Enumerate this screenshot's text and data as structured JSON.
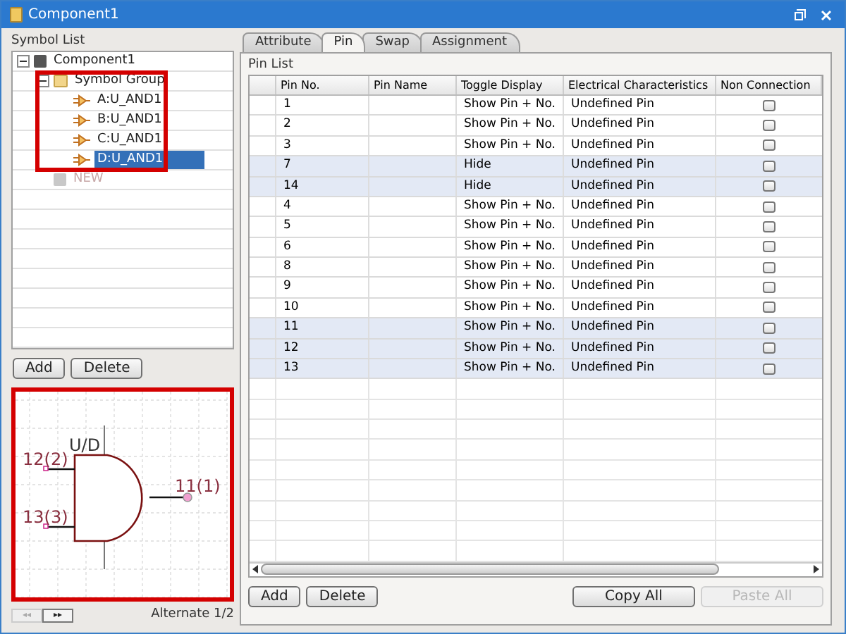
{
  "window": {
    "title": "Component1"
  },
  "symbol_list": {
    "label": "Symbol List",
    "tree": [
      {
        "label": "Component1",
        "kind": "component",
        "expanded": true,
        "selected": false,
        "children": [
          {
            "label": "Symbol Group",
            "kind": "group",
            "expanded": true,
            "selected": false,
            "children": [
              {
                "label": "A:U_AND1",
                "kind": "symbol",
                "selected": false
              },
              {
                "label": "B:U_AND1",
                "kind": "symbol",
                "selected": false
              },
              {
                "label": "C:U_AND1",
                "kind": "symbol",
                "selected": false
              },
              {
                "label": "D:U_AND1",
                "kind": "symbol",
                "selected": true
              }
            ]
          },
          {
            "label": "NEW",
            "kind": "new",
            "disabled": true,
            "selected": false
          }
        ]
      }
    ],
    "buttons": [
      {
        "label": "Add",
        "disabled": false
      },
      {
        "label": "Delete",
        "disabled": false
      }
    ]
  },
  "preview": {
    "unit_label": "U/D",
    "pins": [
      "12(2)",
      "13(3)",
      "11(1)"
    ],
    "nav": [
      "◂◂",
      "▸▸"
    ],
    "alternate": "Alternate 1/2"
  },
  "tabs": [
    {
      "label": "Attribute",
      "selected": false
    },
    {
      "label": "Pin",
      "selected": true
    },
    {
      "label": "Swap",
      "selected": false
    },
    {
      "label": "Assignment",
      "selected": false
    }
  ],
  "pin_list": {
    "label": "Pin List",
    "columns": [
      "Pin No.",
      "Pin Name",
      "Toggle Display",
      "Electrical Characteristics",
      "Non Connection"
    ],
    "rows": [
      {
        "pin_no": "1",
        "toggle": "Show Pin + No.",
        "electrical": "Undefined Pin",
        "non_connection": false,
        "highlighted": false
      },
      {
        "pin_no": "2",
        "toggle": "Show Pin + No.",
        "electrical": "Undefined Pin",
        "non_connection": false,
        "highlighted": false
      },
      {
        "pin_no": "3",
        "toggle": "Show Pin + No.",
        "electrical": "Undefined Pin",
        "non_connection": false,
        "highlighted": false
      },
      {
        "pin_no": "7",
        "toggle": "Hide",
        "electrical": "Undefined Pin",
        "non_connection": false,
        "highlighted": true
      },
      {
        "pin_no": "14",
        "toggle": "Hide",
        "electrical": "Undefined Pin",
        "non_connection": false,
        "highlighted": true
      },
      {
        "pin_no": "4",
        "toggle": "Show Pin + No.",
        "electrical": "Undefined Pin",
        "non_connection": false,
        "highlighted": false
      },
      {
        "pin_no": "5",
        "toggle": "Show Pin + No.",
        "electrical": "Undefined Pin",
        "non_connection": false,
        "highlighted": false
      },
      {
        "pin_no": "6",
        "toggle": "Show Pin + No.",
        "electrical": "Undefined Pin",
        "non_connection": false,
        "highlighted": false
      },
      {
        "pin_no": "8",
        "toggle": "Show Pin + No.",
        "electrical": "Undefined Pin",
        "non_connection": false,
        "highlighted": false
      },
      {
        "pin_no": "9",
        "toggle": "Show Pin + No.",
        "electrical": "Undefined Pin",
        "non_connection": false,
        "highlighted": false
      },
      {
        "pin_no": "10",
        "toggle": "Show Pin + No.",
        "electrical": "Undefined Pin",
        "non_connection": false,
        "highlighted": false
      },
      {
        "pin_no": "11",
        "toggle": "Show Pin + No.",
        "electrical": "Undefined Pin",
        "non_connection": false,
        "highlighted": true
      },
      {
        "pin_no": "12",
        "toggle": "Show Pin + No.",
        "electrical": "Undefined Pin",
        "non_connection": false,
        "highlighted": true
      },
      {
        "pin_no": "13",
        "toggle": "Show Pin + No.",
        "electrical": "Undefined Pin",
        "non_connection": false,
        "highlighted": true
      }
    ],
    "buttons": [
      {
        "label": "Add",
        "disabled": false
      },
      {
        "label": "Delete",
        "disabled": false
      },
      {
        "label": "Copy All",
        "disabled": false
      },
      {
        "label": "Paste All",
        "disabled": true
      }
    ]
  }
}
